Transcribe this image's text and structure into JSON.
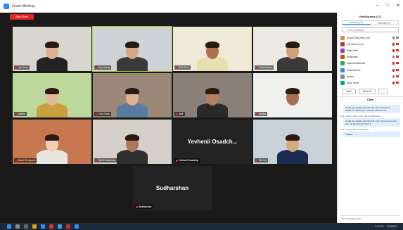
{
  "window": {
    "title": "Zoom Meeting",
    "stop_label": "Stop Share"
  },
  "tiles": [
    {
      "name": "Jun Kwon",
      "muted": true
    },
    {
      "name": "Guy Pinsky",
      "muted": true
    },
    {
      "name": "Ravi Shah",
      "muted": true
    },
    {
      "name": "Ferki Mertens",
      "muted": true
    },
    {
      "name": "Aastha",
      "muted": true
    },
    {
      "name": "Greg Smith",
      "muted": true
    },
    {
      "name": "Amir",
      "muted": true
    },
    {
      "name": "Devika",
      "muted": true
    },
    {
      "name": "Sarah Thompson",
      "muted": true
    },
    {
      "name": "Sai Sri Vaishnavi",
      "muted": true
    },
    {
      "name": "Yevhenii Osadchyi",
      "muted": true
    },
    {
      "name": "Tim Lee",
      "muted": true
    },
    {
      "name": "Sudharshan",
      "muted": true
    }
  ],
  "text_tiles": {
    "yevhenii": "Yevhenii Osadch...",
    "sudharshan": "Sudharshan"
  },
  "panel": {
    "title": "Participants (17)",
    "tabs": [
      "Speaking (13)",
      "Attendee (4)"
    ],
    "search_placeholder": "Find a participant",
    "participants": [
      {
        "name": "Sriram Vijay (Host, me)",
        "color": "#e08a30"
      },
      {
        "name": "Jun Kwon (Co-h)",
        "color": "#c0392b"
      },
      {
        "name": "Salty Gatlin",
        "color": "#8e44ad"
      },
      {
        "name": "Ali Afkarian",
        "color": "#d35400"
      },
      {
        "name": "Harsh Mohammed",
        "color": "#27ae60"
      },
      {
        "name": "Ferki Mertens",
        "color": "#2d8cff"
      },
      {
        "name": "Devika",
        "color": "#7f8c8d"
      },
      {
        "name": "Ruby Torres",
        "color": "#16a085"
      }
    ],
    "btn_invite": "Invite",
    "btn_mute": "Mute All",
    "btn_more": "...",
    "chat_title": "Chat",
    "messages": [
      {
        "text": "Could you please promote the new link back to Sarah's? Thank you, it doesn't work for me.",
        "meta": ""
      },
      {
        "meta": "From Sriram Vijay to Me: (Direct Message)",
        "text": "Could you please promote her now. So everyone can see, as she doesn't have it."
      },
      {
        "meta": "From Guy Pinsky to Everyone:",
        "text": "Thanks"
      }
    ],
    "input_placeholder": "Type message here..."
  },
  "taskbar": {
    "time": "2:17 PM",
    "date": "8/25/2021"
  }
}
